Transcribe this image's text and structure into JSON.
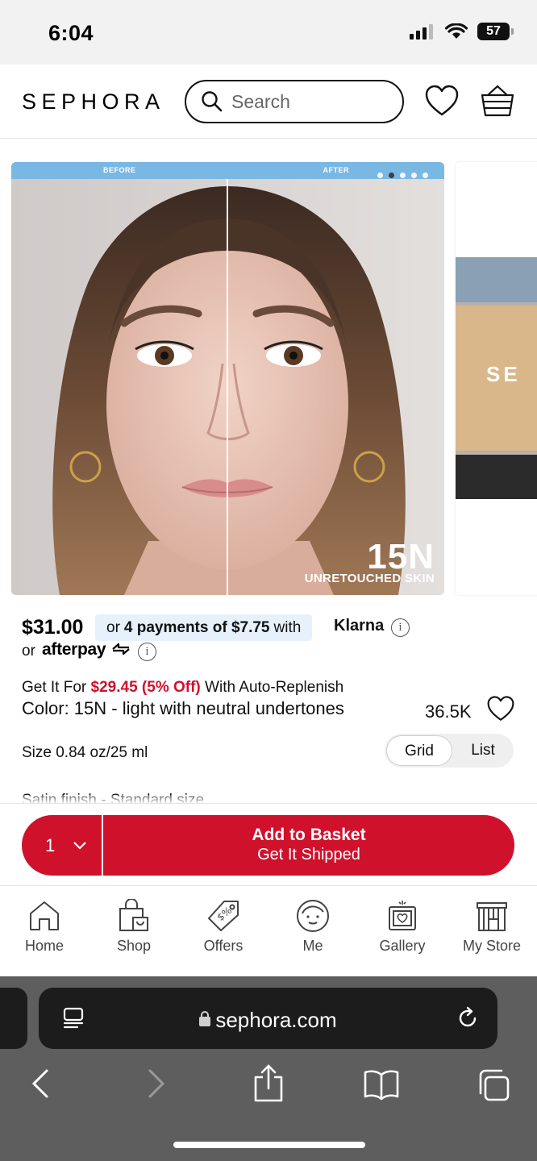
{
  "status_bar": {
    "time": "6:04",
    "battery": "57"
  },
  "header": {
    "logo": "SEPHORA",
    "search_placeholder": "Search",
    "icons": [
      "heart-icon",
      "basket-icon"
    ]
  },
  "carousel": {
    "before_label": "BEFORE",
    "after_label": "AFTER",
    "shade_code": "15N",
    "overlay_caption": "UNRETOUCHED SKIN",
    "dot_count": 5,
    "active_dot": 2,
    "next_slide_text": "SE"
  },
  "product": {
    "price": "$31.00",
    "klarna": {
      "prefix": "or",
      "payments": "4 payments of $7.75",
      "suffix": "with",
      "brand": "Klarna"
    },
    "afterpay": {
      "prefix": "or",
      "brand": "afterpay"
    },
    "replenish": {
      "prefix": "Get It For",
      "sale": "$29.45 (5% Off)",
      "suffix": "With Auto-Replenish"
    },
    "color": "Color: 15N - light with neutral undertones",
    "loves": "36.5K",
    "size": "Size 0.84 oz/25 ml",
    "view_toggle": {
      "grid": "Grid",
      "list": "List",
      "selected": "Grid"
    },
    "finish": "Satin finish - Standard size"
  },
  "purchase": {
    "quantity": "1",
    "add_to_basket": "Add to Basket",
    "shipping": "Get It Shipped",
    "accent_color": "#cf112c"
  },
  "bottom_nav": [
    {
      "label": "Home",
      "icon": "home-icon"
    },
    {
      "label": "Shop",
      "icon": "shop-bag-icon"
    },
    {
      "label": "Offers",
      "icon": "offers-tag-icon"
    },
    {
      "label": "Me",
      "icon": "me-face-icon"
    },
    {
      "label": "Gallery",
      "icon": "gallery-icon"
    },
    {
      "label": "My Store",
      "icon": "store-icon"
    }
  ],
  "browser": {
    "url": "sephora.com",
    "tools": [
      "back-icon",
      "forward-icon",
      "share-icon",
      "bookmarks-icon",
      "tabs-icon"
    ]
  }
}
